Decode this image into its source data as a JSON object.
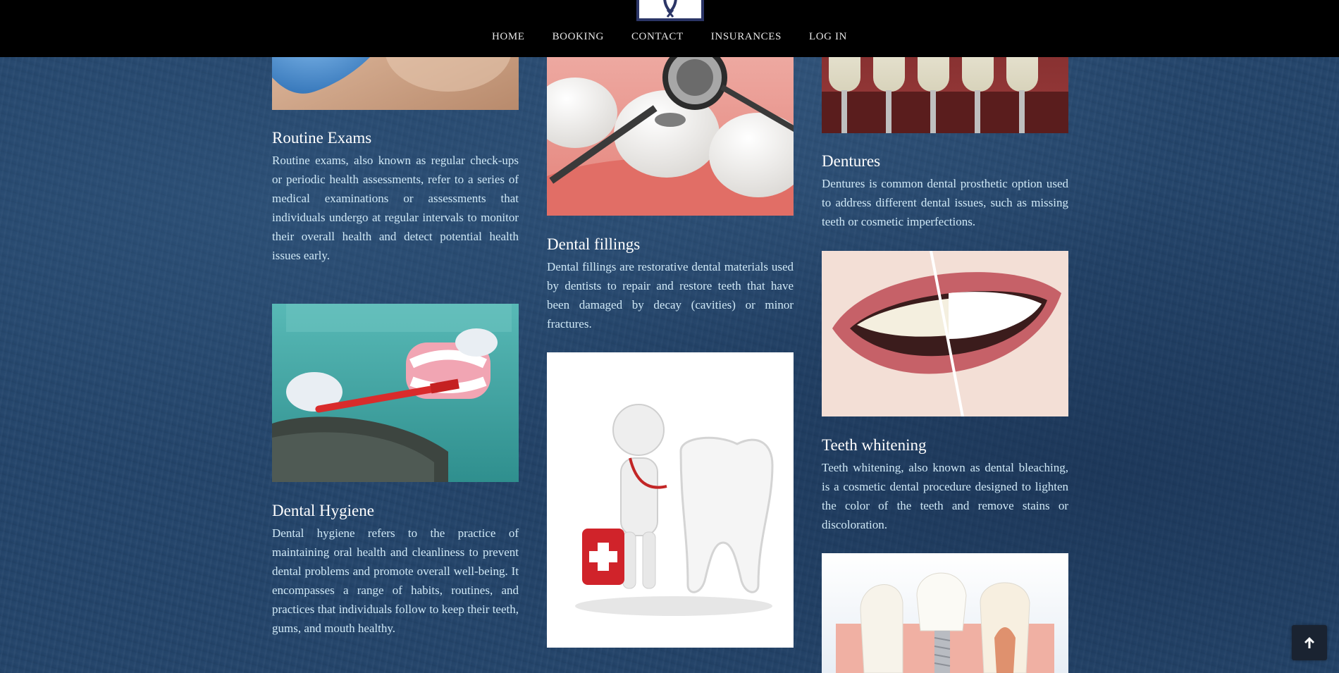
{
  "nav": {
    "items": [
      "HOME",
      "BOOKING",
      "CONTACT",
      "INSURANCES",
      "LOG IN"
    ]
  },
  "services": {
    "routine_exams": {
      "title": "Routine Exams",
      "text": "Routine exams, also known as regular check-ups or periodic health assessments, refer to a series of medical examinations or assessments that individuals undergo at regular intervals to monitor their overall health and detect potential health issues early."
    },
    "dental_hygiene": {
      "title": "Dental Hygiene",
      "text": "Dental hygiene refers to the practice of maintaining oral health and cleanliness to prevent dental problems and promote overall well-being. It encompasses a range of habits, routines, and practices that individuals follow to keep their teeth, gums, and mouth healthy."
    },
    "dental_fillings": {
      "title": "Dental fillings",
      "text": "Dental fillings are restorative dental materials used by dentists to repair and restore teeth that have been damaged by decay (cavities) or minor fractures."
    },
    "dentures": {
      "title": "Dentures",
      "text": "Dentures is common dental prosthetic option used to address different dental issues, such as missing teeth or cosmetic imperfections."
    },
    "teeth_whitening": {
      "title": "Teeth whitening",
      "text": "Teeth whitening, also known as dental bleaching, is a cosmetic dental procedure designed to lighten the color of the teeth and remove stains or discoloration."
    }
  },
  "icons": {
    "back_to_top": "arrow-up-icon"
  },
  "colors": {
    "header_bg": "#000000",
    "page_bg": "#24456b",
    "title": "#ffffff",
    "body_text": "#cfe8f6",
    "logo_border": "#2b3566"
  }
}
